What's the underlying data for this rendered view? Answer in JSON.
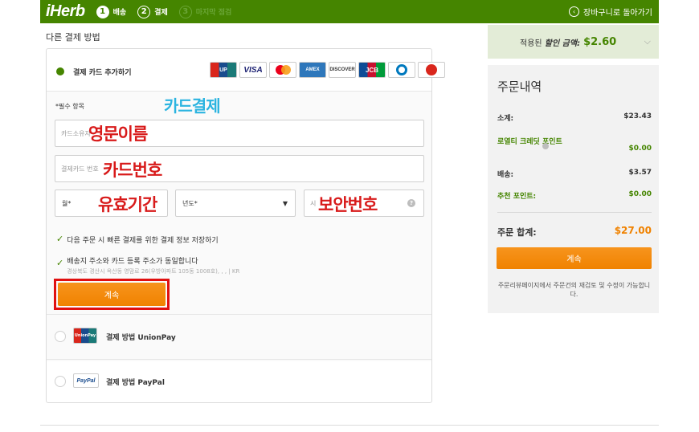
{
  "header": {
    "logo": "iHerb",
    "steps": [
      {
        "num": "1",
        "label": "배송"
      },
      {
        "num": "2",
        "label": "결제"
      },
      {
        "num": "3",
        "label": "마지막 점검"
      }
    ],
    "back_label": "장바구니로 돌아가기"
  },
  "section_title": "다른 결제 방법",
  "card_option": {
    "label": "결제 카드 추가하기",
    "logos": [
      "UnionPay",
      "VISA",
      "MasterCard",
      "AMERICAN EXPRESS",
      "DISCOVER",
      "JCB",
      "Diners Club",
      "Other"
    ]
  },
  "form": {
    "required_note": "*필수 항목",
    "name_placeholder": "카드소유자",
    "number_placeholder": "결제카드 번호",
    "month_placeholder": "월*",
    "year_placeholder": "년도*",
    "cvv_placeholder": "시",
    "save_checkbox": "다음 주문 시 빠른 결제를 위한 결제 정보 저장하기",
    "address_checkbox": "배송지 주소와 카드 등록 주소가 동일합니다",
    "address_text": "경상북도 경산시 옥산동 영맘로 26(우방아파트 105동 1008호), , , | KR",
    "continue": "계속"
  },
  "annotations": {
    "title": "카드결제",
    "name": "영문이름",
    "number": "카드번호",
    "expiry": "유효기간",
    "cvv": "보안번호"
  },
  "alt_options": [
    {
      "label": "결제 방법 UnionPay",
      "logo": "UnionPay"
    },
    {
      "label": "결제 방법 PayPal",
      "logo": "PayPal"
    }
  ],
  "discount": {
    "prefix": "적용된",
    "emphasis": "할인 금액:",
    "amount": "$2.60"
  },
  "summary": {
    "title": "주문내역",
    "rows": [
      {
        "label": "소계:",
        "value": "$23.43"
      },
      {
        "label": "로열티 크레딧 포인트",
        "value": "$0.00"
      },
      {
        "label": "배송:",
        "value": "$3.57"
      },
      {
        "label": "추천 포인트:",
        "value": "$0.00"
      }
    ],
    "total_label": "주문 합계:",
    "total_value": "$27.00",
    "button": "계속",
    "note": "주문리뷰페이지에서 주문건의 재검토 및 수정이 가능합니다."
  },
  "colors": {
    "brand_green": "#458500",
    "orange": "#f08200",
    "highlight_red": "#e01010",
    "annotation_blue": "#2bb4e0"
  }
}
